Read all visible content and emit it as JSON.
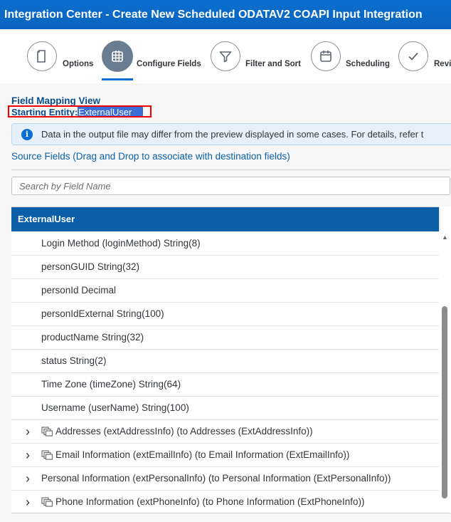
{
  "window": {
    "title": "Integration Center - Create New Scheduled ODATAV2 COAPI Input Integration"
  },
  "wizard": {
    "steps": [
      {
        "label": "Options",
        "icon": "document-icon",
        "active": false
      },
      {
        "label": "Configure Fields",
        "icon": "grid-icon",
        "active": true
      },
      {
        "label": "Filter and Sort",
        "icon": "filter-icon",
        "active": false
      },
      {
        "label": "Scheduling",
        "icon": "calendar-icon",
        "active": false
      },
      {
        "label": "Revi",
        "icon": "checkmark-icon",
        "active": false
      }
    ]
  },
  "mapping": {
    "title": "Field Mapping View",
    "starting_label": "Starting Entity:",
    "starting_value": "ExternalUser"
  },
  "info": {
    "icon": "info-icon",
    "text": "Data in the output file may differ from the preview displayed in some cases. For details, refer t"
  },
  "source": {
    "label": "Source Fields (Drag and Drop to associate with destination fields)"
  },
  "search": {
    "placeholder": "Search by Field Name",
    "value": ""
  },
  "tree": {
    "header": "ExternalUser",
    "fields": [
      "Login Method (loginMethod) String(8)",
      "personGUID String(32)",
      "personId Decimal",
      "personIdExternal String(100)",
      "productName String(32)",
      "status String(2)",
      "Time Zone (timeZone) String(64)",
      "Username (userName) String(100)"
    ],
    "navigations": [
      {
        "label": "Addresses (extAddressInfo) (to Addresses (ExtAddressInfo))",
        "multi": true
      },
      {
        "label": "Email Information (extEmailInfo) (to Email Information (ExtEmailInfo))",
        "multi": true
      },
      {
        "label": "Personal Information (extPersonalInfo) (to Personal Information (ExtPersonalInfo))",
        "multi": false
      },
      {
        "label": "Phone Information (extPhoneInfo) (to Phone Information (ExtPhoneInfo))",
        "multi": true
      }
    ]
  },
  "colors": {
    "brand": "#0a6ed1",
    "header": "#0a5fa8",
    "highlight": "#3a6fd8",
    "annotation": "#ee0000"
  }
}
